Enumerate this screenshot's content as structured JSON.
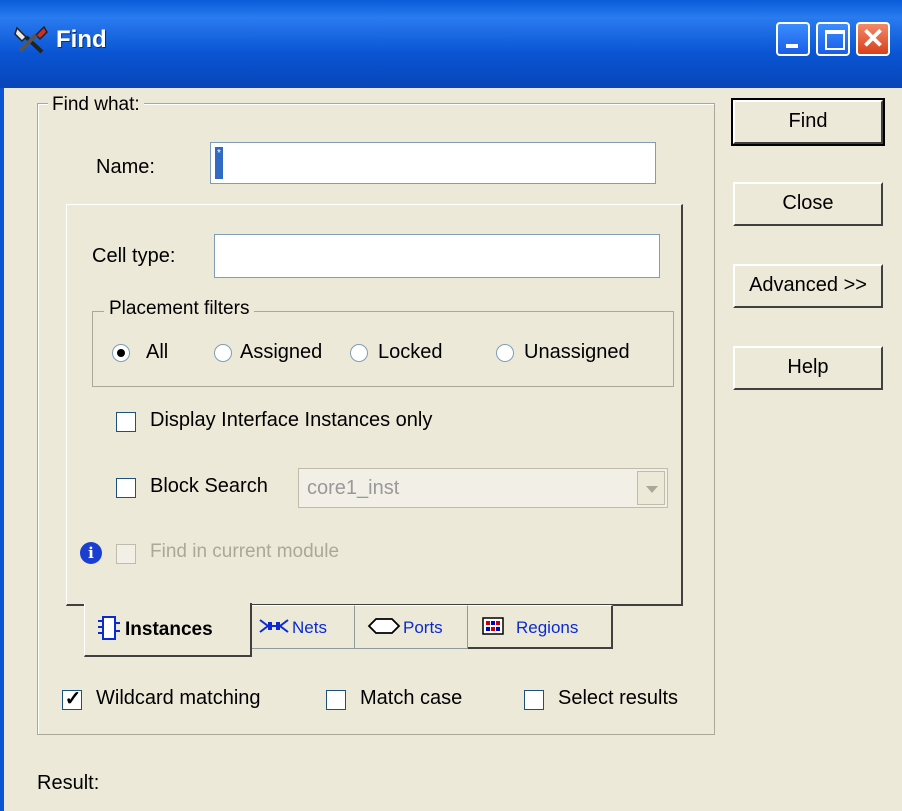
{
  "window": {
    "title": "Find",
    "icon": "wrench-screwdriver-icon",
    "controls": [
      "minimize-icon",
      "maximize-icon",
      "close-icon"
    ],
    "accent": "#0a55d4"
  },
  "find_what": {
    "legend": "Find what:",
    "name_label": "Name:",
    "name_value": "*",
    "tab_panel": {
      "cell_type_label": "Cell type:",
      "cell_type_value": "",
      "placement_filters": {
        "legend": "Placement filters",
        "options": [
          "All",
          "Assigned",
          "Locked",
          "Unassigned"
        ],
        "selected": "All"
      },
      "display_interface_label": "Display Interface Instances only",
      "display_interface_checked": false,
      "block_search_label": "Block Search",
      "block_search_checked": false,
      "block_search_value": "core1_inst",
      "find_in_module_label": "Find in current module",
      "find_in_module_checked": false,
      "info_icon": "info-icon"
    },
    "tabs": [
      {
        "label": "Instances",
        "icon": "instance-icon",
        "active": true
      },
      {
        "label": "Nets",
        "icon": "net-icon",
        "active": false
      },
      {
        "label": "Ports",
        "icon": "port-icon",
        "active": false
      },
      {
        "label": "Regions",
        "icon": "region-icon",
        "active": false
      }
    ],
    "options": {
      "wildcard_label": "Wildcard matching",
      "wildcard_checked": true,
      "match_case_label": "Match case",
      "match_case_checked": false,
      "select_results_label": "Select results",
      "select_results_checked": false
    }
  },
  "buttons": {
    "find": "Find",
    "close": "Close",
    "advanced": "Advanced >>",
    "help": "Help"
  },
  "result_label": "Result:"
}
